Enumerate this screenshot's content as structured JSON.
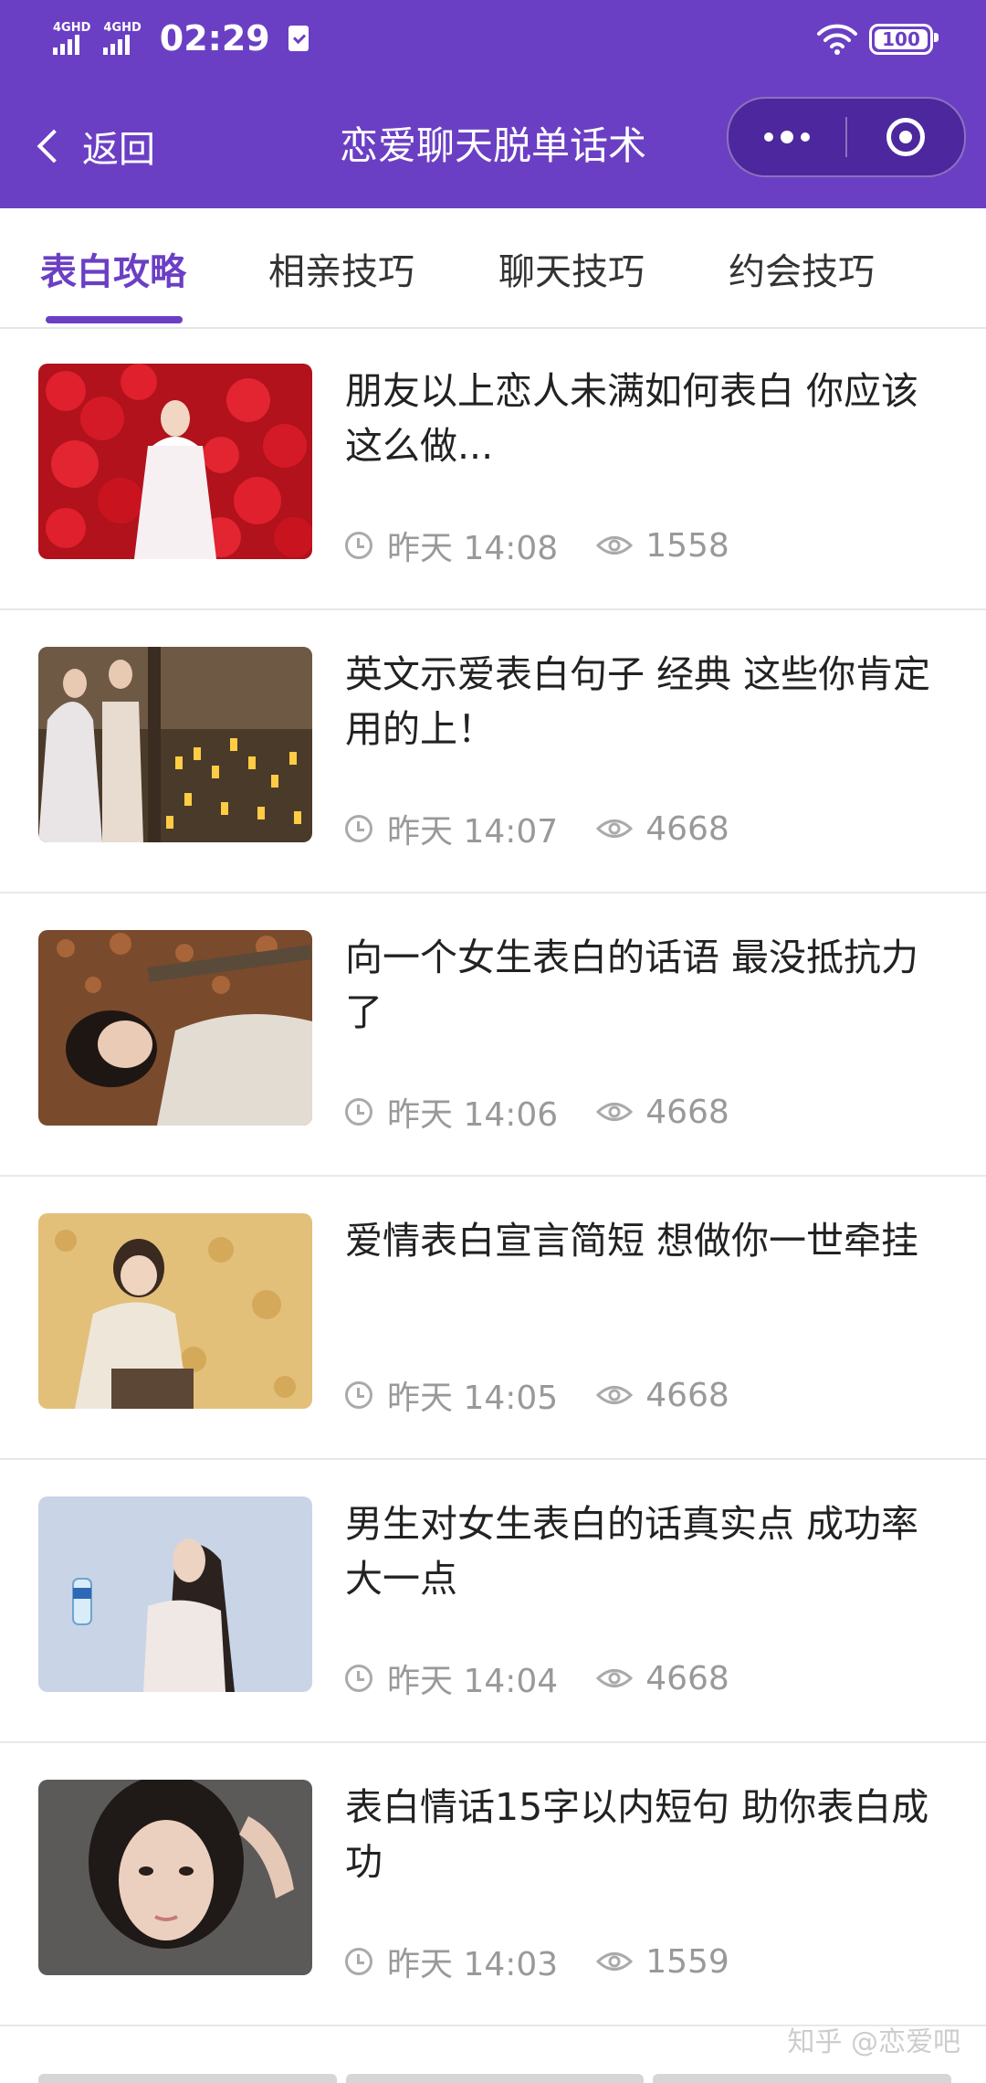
{
  "status_bar": {
    "signal1": "4GHD",
    "signal2": "4GHD",
    "time": "02:29",
    "battery": "100"
  },
  "nav": {
    "back_label": "返回",
    "title": "恋爱聊天脱单话术"
  },
  "tabs": [
    {
      "label": "表白攻略",
      "active": true
    },
    {
      "label": "相亲技巧",
      "active": false
    },
    {
      "label": "聊天技巧",
      "active": false
    },
    {
      "label": "约会技巧",
      "active": false
    }
  ],
  "articles": [
    {
      "title": "朋友以上恋人未满如何表白 你应该这么做...",
      "time": "昨天 14:08",
      "views": "1558"
    },
    {
      "title": "英文示爱表白句子 经典 这些你肯定用的上！",
      "time": "昨天 14:07",
      "views": "4668"
    },
    {
      "title": "向一个女生表白的话语 最没抵抗力了",
      "time": "昨天 14:06",
      "views": "4668"
    },
    {
      "title": "爱情表白宣言简短 想做你一世牵挂",
      "time": "昨天 14:05",
      "views": "4668"
    },
    {
      "title": "男生对女生表白的话真实点 成功率大一点",
      "time": "昨天 14:04",
      "views": "4668"
    },
    {
      "title": "表白情话15字以内短句 助你表白成功",
      "time": "昨天 14:03",
      "views": "1559"
    }
  ],
  "watermark": "知乎 @恋爱吧",
  "colors": {
    "brand": "#6b3fc4",
    "text": "#222222",
    "meta": "#999999"
  }
}
